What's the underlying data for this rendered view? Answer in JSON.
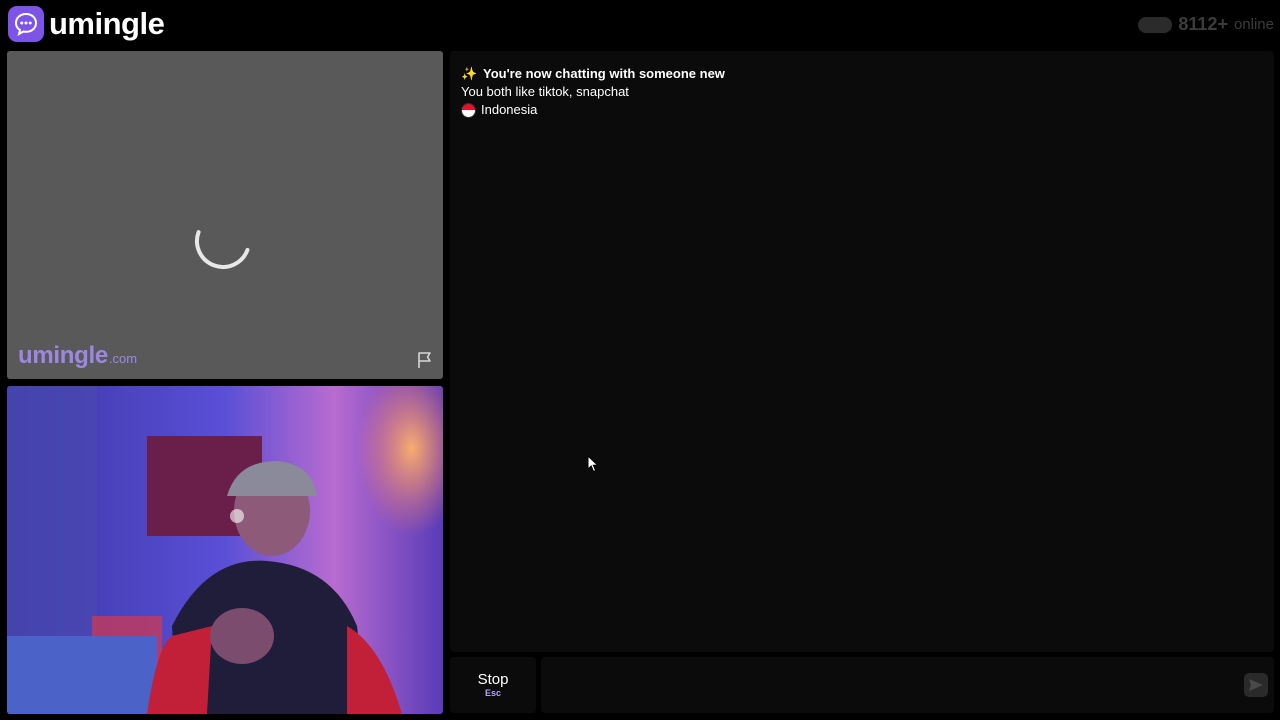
{
  "header": {
    "logo_text": "umingle",
    "online_count": "8112+",
    "online_label": "online"
  },
  "stranger": {
    "watermark_main": "umingle",
    "watermark_domain": ".com",
    "loading": true
  },
  "chat": {
    "status_line": "You're now chatting with someone new",
    "interests_line": "You both like tiktok, snapchat",
    "country": "Indonesia"
  },
  "controls": {
    "stop_label": "Stop",
    "stop_shortcut": "Esc",
    "message_value": "",
    "send_icon": "send-arrow-icon"
  },
  "colors": {
    "brand": "#7d55e6",
    "shortcut": "#b6a4ff",
    "panel": "#0b0b0b",
    "indonesia_red": "#e8112d"
  }
}
